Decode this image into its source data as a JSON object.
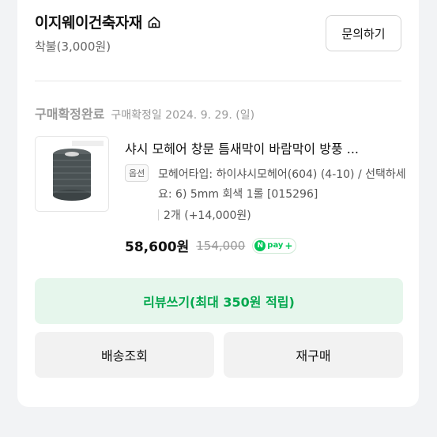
{
  "store": {
    "name": "이지웨이건축자재",
    "shipping": "착불(3,000원)",
    "inquiry_label": "문의하기"
  },
  "order": {
    "status": "구매확정완료",
    "confirm_date": "구매확정일 2024. 9. 29. (일)",
    "product_title": "샤시 모헤어 창문 틈새막이 바람막이 방풍 ...",
    "option_badge": "옵션",
    "option_text": "모헤어타입: 하이샤시모헤어(604) (4-10) / 선택하세요: 6) 5mm 회색 1롤 [015296]",
    "quantity": "2개 (+14,000원)",
    "price": "58,600원",
    "original_price": "154,000",
    "npay_label": "pay"
  },
  "actions": {
    "review_label": "리뷰쓰기(최대 350원 적립)",
    "track_label": "배송조회",
    "reorder_label": "재구매"
  },
  "colors": {
    "naver_green": "#03c75a",
    "review_bg": "#e6f6ec"
  }
}
